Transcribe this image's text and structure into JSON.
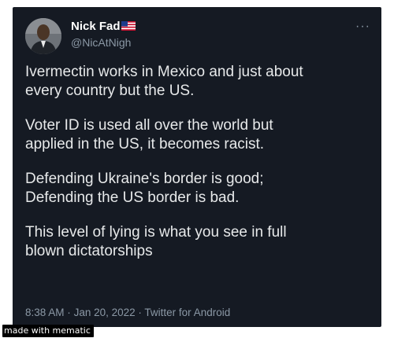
{
  "tweet": {
    "author": {
      "display_name": "Nick Fad",
      "handle": "@NicAtNigh",
      "avatar_icon": "user-avatar",
      "flag_icon": "us-flag-icon"
    },
    "more_label": "···",
    "paragraphs": [
      "Ivermectin works in Mexico and just about\nevery country but the US.",
      "Voter ID is used all over the world but\napplied in the US, it becomes racist.",
      "Defending Ukraine's border is good;\nDefending the US border is bad.",
      "This level of lying is what you see in full\nblown dictatorships"
    ],
    "time": "8:38 AM",
    "separator": "·",
    "date": "Jan 20, 2022",
    "source": "Twitter for Android"
  },
  "watermark": {
    "text": "made with mematic"
  },
  "colors": {
    "card_background": "#151a23",
    "text_primary": "#e7e9ea",
    "text_secondary": "#8b98a5"
  }
}
